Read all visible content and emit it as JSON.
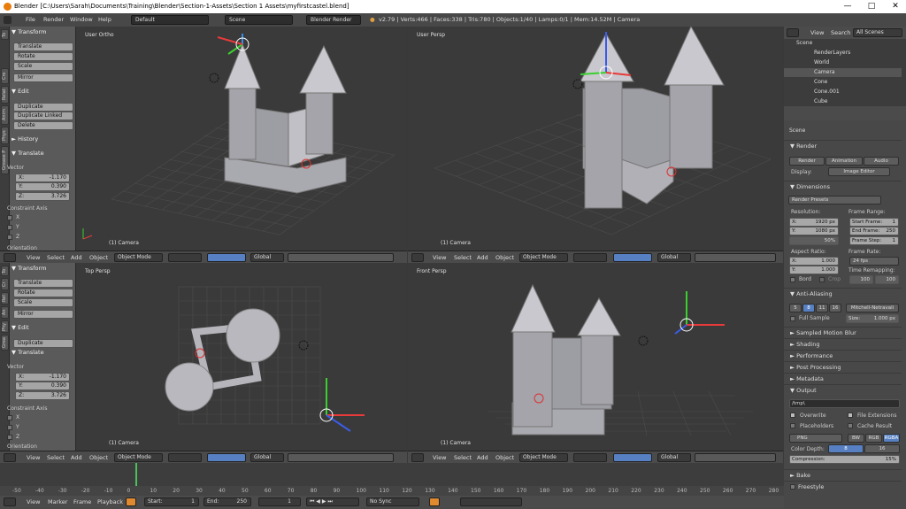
{
  "window": {
    "title": "Blender [C:\\Users\\Sarah\\Documents\\Training\\Blender\\Section-1-Assets\\Section 1 Assets\\myfirstcastel.blend]",
    "minimize_glyph": "—",
    "maximize_glyph": "□",
    "close_glyph": "✕"
  },
  "menubar": {
    "items": [
      "File",
      "Render",
      "Window",
      "Help"
    ],
    "layout": "Default",
    "scene": "Scene",
    "engine": "Blender Render",
    "stats": "v2.79 | Verts:466 | Faces:338 | Tris:780 | Objects:1/40 | Lamps:0/1 | Mem:14.52M | Camera"
  },
  "toolshelf": {
    "tabs": [
      "To",
      "Cre",
      "Relat",
      "Anim",
      "Phys",
      "Grease P"
    ],
    "transform": {
      "header": "Transform",
      "buttons": [
        "Translate",
        "Rotate",
        "Scale"
      ],
      "mirror": "Mirror"
    },
    "edit": {
      "header": "Edit",
      "buttons": [
        "Duplicate",
        "Duplicate Linked",
        "Delete"
      ]
    },
    "history": "History",
    "operator": {
      "header": "Translate",
      "vector_label": "Vector",
      "x_label": "X:",
      "y_label": "Y:",
      "z_label": "Z:",
      "x": "-1.170",
      "y": "0.390",
      "z": "3.726",
      "constraint_label": "Constraint Axis",
      "axes": [
        "X",
        "Y",
        "Z"
      ],
      "orientation": "Orientation"
    }
  },
  "toolshelf2": {
    "tabs": [
      "To",
      "Cr",
      "Rel",
      "An",
      "Phy",
      "Grea"
    ],
    "transform": {
      "header": "Transform",
      "buttons": [
        "Translate",
        "Rotate",
        "Scale"
      ],
      "mirror": "Mirror"
    },
    "edit": {
      "header": "Edit",
      "buttons": [
        "Duplicate"
      ]
    },
    "operator": {
      "header": "Translate",
      "vector_label": "Vector",
      "x_label": "X:",
      "y_label": "Y:",
      "z_label": "Z:",
      "x": "-1.170",
      "y": "0.390",
      "z": "3.726",
      "constraint_label": "Constraint Axis",
      "axes": [
        "X",
        "Y",
        "Z"
      ],
      "orientation": "Orientation"
    }
  },
  "viewports": {
    "top_left": {
      "label": "User Ortho",
      "object": "(1) Camera"
    },
    "top_right": {
      "label": "User Persp",
      "object": "(1) Camera"
    },
    "bottom_left": {
      "label": "Top Persp",
      "object": "(1) Camera"
    },
    "bottom_right": {
      "label": "Front Persp",
      "object": "(1) Camera"
    }
  },
  "view3d_header": {
    "menus": [
      "View",
      "Select",
      "Add",
      "Object"
    ],
    "mode": "Object Mode",
    "orientation": "Global"
  },
  "outliner": {
    "menus": [
      "View",
      "Search"
    ],
    "filter": "All Scenes",
    "items": [
      "Scene",
      "RenderLayers",
      "World",
      "Camera",
      "Cone",
      "Cone.001",
      "Cube"
    ]
  },
  "properties": {
    "scene": "Scene",
    "render": {
      "header": "Render",
      "buttons": [
        "Render",
        "Animation",
        "Audio"
      ],
      "display_label": "Display:",
      "display": "Image Editor"
    },
    "dimensions": {
      "header": "Dimensions",
      "presets": "Render Presets",
      "resolution_label": "Resolution:",
      "res_x_label": "X:",
      "res_x": "1920 px",
      "res_y_label": "Y:",
      "res_y": "1080 px",
      "res_pct": "50%",
      "frame_range_label": "Frame Range:",
      "start_label": "Start Frame:",
      "start": "1",
      "end_label": "End Frame:",
      "end": "250",
      "step_label": "Frame Step:",
      "step": "1",
      "aspect_label": "Aspect Ratio:",
      "asp_x_label": "X:",
      "asp_x": "1.000",
      "asp_y_label": "Y:",
      "asp_y": "1.000",
      "frame_rate_label": "Frame Rate:",
      "fps": "24 fps",
      "time_remap_label": "Time Remapping:",
      "remap_old": "100",
      "remap_new": "100",
      "border": "Bord",
      "crop": "Crop"
    },
    "aa": {
      "header": "Anti-Aliasing",
      "samples": [
        "5",
        "8",
        "11",
        "16"
      ],
      "active_sample": "8",
      "filter": "Mitchell-Netravali",
      "full_sample": "Full Sample",
      "size_label": "Size:",
      "size": "1.000 px"
    },
    "sections": [
      "Sampled Motion Blur",
      "Shading",
      "Performance",
      "Post Processing",
      "Metadata"
    ],
    "output": {
      "header": "Output",
      "path": "/tmp\\",
      "overwrite": "Overwrite",
      "file_ext": "File Extensions",
      "placeholders": "Placeholders",
      "cache": "Cache Result",
      "format": "PNG",
      "color_modes": [
        "BW",
        "RGB",
        "RGBA"
      ],
      "active_color": "RGBA",
      "depth_label": "Color Depth:",
      "depths": [
        "8",
        "16"
      ],
      "active_depth": "8",
      "compression_label": "Compression:",
      "compression": "15%"
    },
    "bottom_sections": [
      "Bake",
      "Freestyle"
    ]
  },
  "timeline": {
    "ticks": [
      "-50",
      "-40",
      "-30",
      "-20",
      "-10",
      "0",
      "10",
      "20",
      "30",
      "40",
      "50",
      "60",
      "70",
      "80",
      "90",
      "100",
      "110",
      "120",
      "130",
      "140",
      "150",
      "160",
      "170",
      "180",
      "190",
      "200",
      "210",
      "220",
      "230",
      "240",
      "250",
      "260",
      "270",
      "280"
    ],
    "menus": [
      "View",
      "Marker",
      "Frame",
      "Playback"
    ],
    "start_label": "Start:",
    "start": "1",
    "end_label": "End:",
    "end": "250",
    "current": "1",
    "sync": "No Sync"
  }
}
